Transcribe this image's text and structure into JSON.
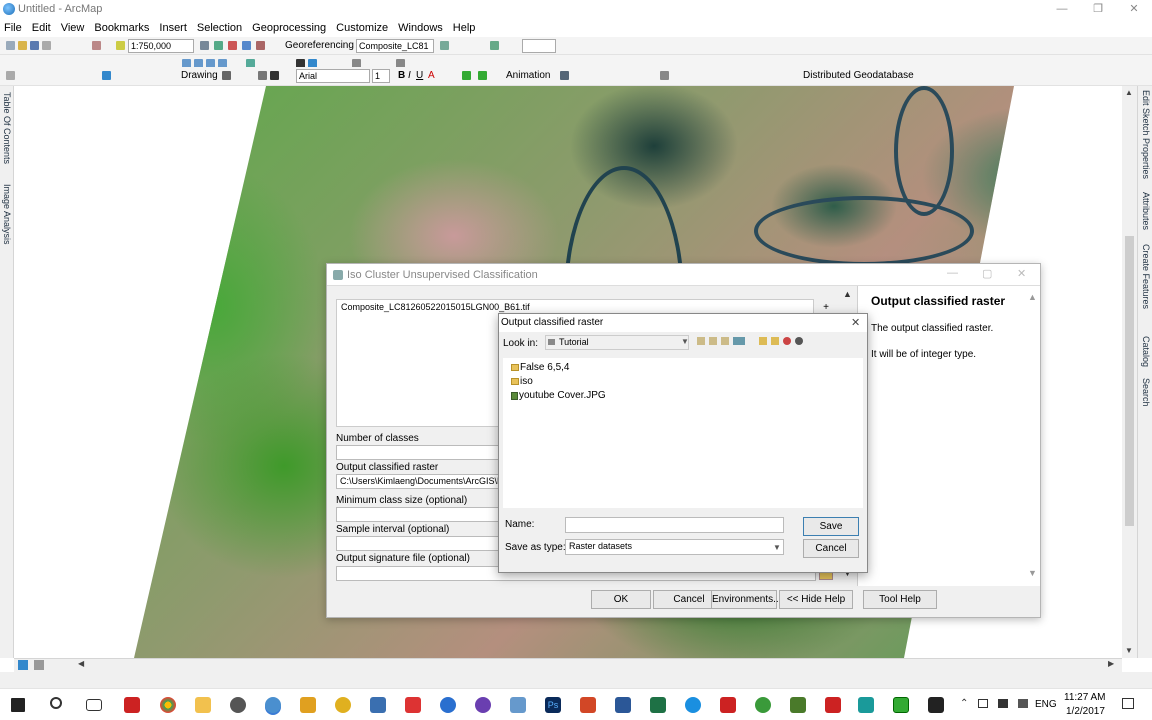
{
  "app": {
    "title": "Untitled - ArcMap"
  },
  "menu": [
    "File",
    "Edit",
    "View",
    "Bookmarks",
    "Insert",
    "Selection",
    "Geoprocessing",
    "Customize",
    "Windows",
    "Help"
  ],
  "toolbar": {
    "scale": "1:750,000",
    "georef_label": "Georeferencing",
    "georef_layer": "Composite_LC81",
    "drawing_label": "Drawing",
    "font_name": "Arial",
    "font_size": "1",
    "animation_label": "Animation",
    "distgeo_label": "Distributed Geodatabase"
  },
  "left_dock": [
    "Table Of Contents",
    "Image Analysis"
  ],
  "right_dock": [
    "Edit Sketch Properties",
    "Attributes",
    "Create Features",
    "Catalog",
    "Search"
  ],
  "iso_dialog": {
    "title": "Iso Cluster Unsupervised Classification",
    "input_raster": "Composite_LC81260522015015LGN00_B61.tif",
    "labels": {
      "num_classes": "Number of classes",
      "output_raster": "Output classified raster",
      "min_class": "Minimum class size (optional)",
      "sample_interval": "Sample interval (optional)",
      "signature": "Output signature file (optional)"
    },
    "output_value": "C:\\Users\\Kimlaeng\\Documents\\ArcGIS\\Def",
    "help": {
      "heading": "Output classified raster",
      "line1": "The output classified raster.",
      "line2": "It will be of integer type."
    },
    "buttons": {
      "ok": "OK",
      "cancel": "Cancel",
      "env": "Environments...",
      "hide_help": "<< Hide Help",
      "tool_help": "Tool Help"
    }
  },
  "save_dialog": {
    "title": "Output classified raster",
    "look_in_label": "Look in:",
    "look_in_value": "Tutorial",
    "files": [
      "False 6,5,4",
      "iso",
      "youtube Cover.JPG"
    ],
    "name_label": "Name:",
    "name_value": "",
    "save_type_label": "Save as type:",
    "save_type_value": "Raster datasets",
    "save_btn": "Save",
    "cancel_btn": "Cancel"
  },
  "taskbar": {
    "lang": "ENG",
    "time": "11:27 AM",
    "date": "1/2/2017"
  }
}
